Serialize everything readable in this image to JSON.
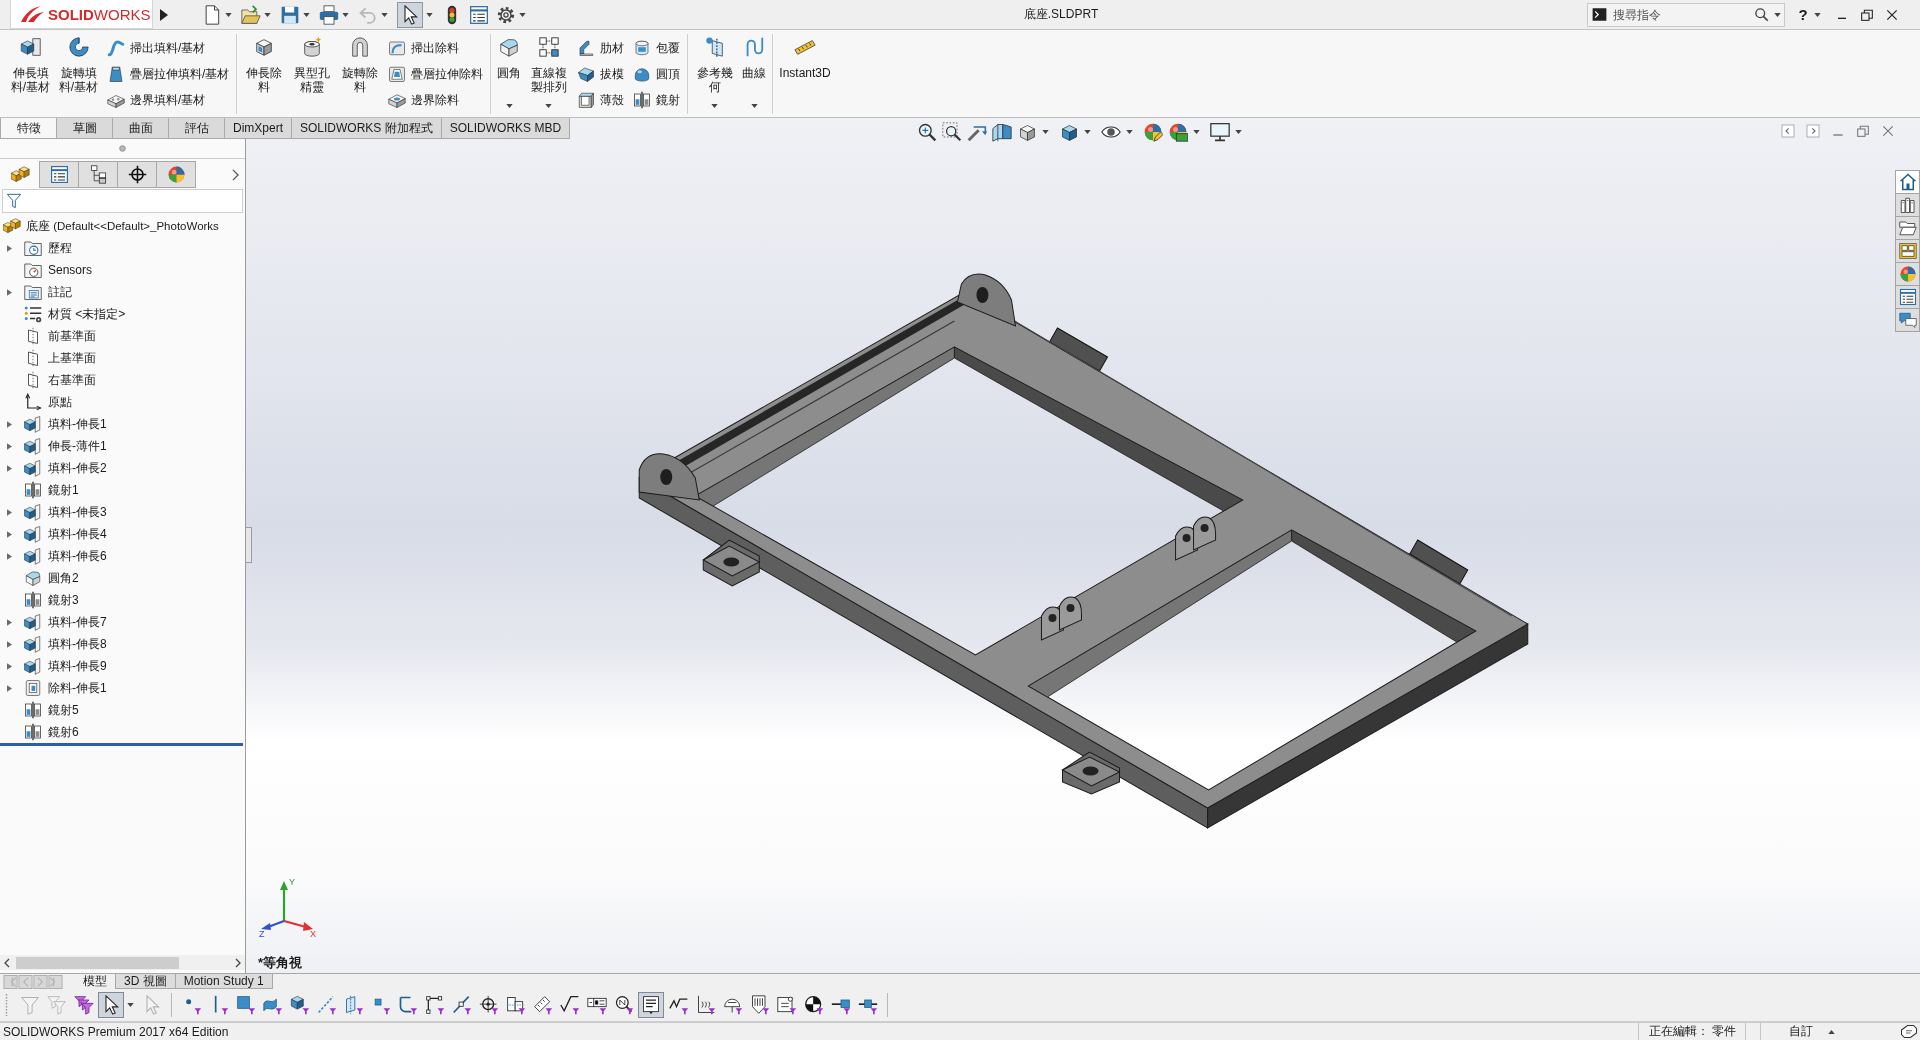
{
  "title_bar": {
    "logo": "**SOLID**WORKS",
    "document_title": "底座.SLDPRT",
    "search": {
      "placeholder": "搜尋指令"
    },
    "help": "?"
  },
  "quick_access": {
    "select_on": true,
    "undo_disabled": true
  },
  "ribbon": {
    "groups": [
      {
        "large": [
          {
            "label": "伸長填料/基材",
            "kind": "extrude_boss",
            "dropdown": false
          },
          {
            "label": "旋轉填料/基材",
            "kind": "revolve_boss",
            "dropdown": false
          }
        ],
        "columns": [
          [
            {
              "label": "掃出填料/基材",
              "kind": "sweep_boss"
            },
            {
              "label": "疊層拉伸填料/基材",
              "kind": "loft_boss"
            },
            {
              "label": "邊界填料/基材",
              "kind": "boundary_boss"
            }
          ]
        ]
      },
      {
        "large": [
          {
            "label": "伸長除料",
            "kind": "extrude_cut",
            "dropdown": false
          },
          {
            "label": "異型孔精靈",
            "kind": "hole_wizard",
            "dropdown": false
          },
          {
            "label": "旋轉除料",
            "kind": "revolve_cut",
            "dropdown": false
          }
        ],
        "columns": [
          [
            {
              "label": "掃出除料",
              "kind": "sweep_cut"
            },
            {
              "label": "疊層拉伸除料",
              "kind": "loft_cut"
            },
            {
              "label": "邊界除料",
              "kind": "boundary_cut"
            }
          ]
        ]
      },
      {
        "large": [
          {
            "label": "圓角",
            "kind": "fillet",
            "dropdown": true
          },
          {
            "label": "直線複製排列",
            "kind": "linear_pattern",
            "dropdown": true
          }
        ],
        "columns": [
          [
            {
              "label": "肋材",
              "kind": "rib"
            },
            {
              "label": "拔模",
              "kind": "draft"
            },
            {
              "label": "薄殼",
              "kind": "shell"
            }
          ],
          [
            {
              "label": "包覆",
              "kind": "wrap"
            },
            {
              "label": "圓頂",
              "kind": "dome"
            },
            {
              "label": "鏡射",
              "kind": "mirror"
            }
          ]
        ]
      },
      {
        "large": [
          {
            "label": "參考幾何",
            "kind": "reference_geometry",
            "dropdown": true
          },
          {
            "label": "曲線",
            "kind": "curves",
            "dropdown": true
          }
        ]
      }
    ],
    "instant3d": {
      "label": "Instant3D"
    }
  },
  "command_tabs": [
    {
      "label": "特徵",
      "selected": true
    },
    {
      "label": "草圖",
      "selected": false
    },
    {
      "label": "曲面",
      "selected": false
    },
    {
      "label": "評估",
      "selected": false
    },
    {
      "label": "DimXpert",
      "selected": false
    },
    {
      "label": "SOLIDWORKS 附加程式",
      "selected": false
    },
    {
      "label": "SOLIDWORKS MBD",
      "selected": false
    }
  ],
  "feature_manager": {
    "tabs": [
      {
        "kind": "feature_tree",
        "selected": true
      },
      {
        "kind": "property",
        "selected": false
      },
      {
        "kind": "configuration",
        "selected": false
      },
      {
        "kind": "dimxpert",
        "selected": false
      },
      {
        "kind": "display",
        "selected": false
      }
    ],
    "root": "底座 (Default<<Default>_PhotoWorks",
    "items": [
      {
        "label": "歷程",
        "kind": "history",
        "expandable": true
      },
      {
        "label": "Sensors",
        "kind": "sensors",
        "expandable": false
      },
      {
        "label": "註記",
        "kind": "annotations",
        "expandable": true
      },
      {
        "label": "材質 <未指定>",
        "kind": "material",
        "expandable": false
      },
      {
        "label": "前基準面",
        "kind": "plane",
        "expandable": false
      },
      {
        "label": "上基準面",
        "kind": "plane",
        "expandable": false
      },
      {
        "label": "右基準面",
        "kind": "plane",
        "expandable": false
      },
      {
        "label": "原點",
        "kind": "origin",
        "expandable": false
      },
      {
        "label": "填料-伸長1",
        "kind": "extrude",
        "expandable": true
      },
      {
        "label": "伸長-薄件1",
        "kind": "extrude",
        "expandable": true
      },
      {
        "label": "填料-伸長2",
        "kind": "extrude",
        "expandable": true
      },
      {
        "label": "鏡射1",
        "kind": "mirror",
        "expandable": false
      },
      {
        "label": "填料-伸長3",
        "kind": "extrude",
        "expandable": true
      },
      {
        "label": "填料-伸長4",
        "kind": "extrude",
        "expandable": true
      },
      {
        "label": "填料-伸長6",
        "kind": "extrude",
        "expandable": true
      },
      {
        "label": "圓角2",
        "kind": "fillet",
        "expandable": false
      },
      {
        "label": "鏡射3",
        "kind": "mirror",
        "expandable": false
      },
      {
        "label": "填料-伸長7",
        "kind": "extrude",
        "expandable": true
      },
      {
        "label": "填料-伸長8",
        "kind": "extrude",
        "expandable": true
      },
      {
        "label": "填料-伸長9",
        "kind": "extrude",
        "expandable": true
      },
      {
        "label": "除料-伸長1",
        "kind": "cut",
        "expandable": true
      },
      {
        "label": "鏡射5",
        "kind": "mirror",
        "expandable": false
      },
      {
        "label": "鏡射6",
        "kind": "mirror",
        "expandable": false
      }
    ]
  },
  "graphics": {
    "view_name": "*等角視",
    "triad": {
      "x": "X",
      "y": "Y",
      "z": "Z"
    }
  },
  "task_pane": [
    {
      "kind": "home",
      "selected": true
    },
    {
      "kind": "library",
      "selected": false
    },
    {
      "kind": "explorer",
      "selected": false
    },
    {
      "kind": "view_palette",
      "selected": false
    },
    {
      "kind": "appearances",
      "selected": false
    },
    {
      "kind": "custom_properties",
      "selected": false
    },
    {
      "kind": "forum",
      "selected": false
    }
  ],
  "bottom_tabs": {
    "nav_disabled": true,
    "tabs": [
      {
        "label": "模型",
        "selected": true
      },
      {
        "label": "3D 視圖",
        "selected": false
      },
      {
        "label": "Motion Study 1",
        "selected": false
      }
    ]
  },
  "selection_toolbar": {
    "select_on": true,
    "annotation_on": true
  },
  "status_bar": {
    "edition": "SOLIDWORKS Premium 2017 x64 Edition",
    "editing": "正在編輯： 零件",
    "unit_system": "自訂"
  }
}
